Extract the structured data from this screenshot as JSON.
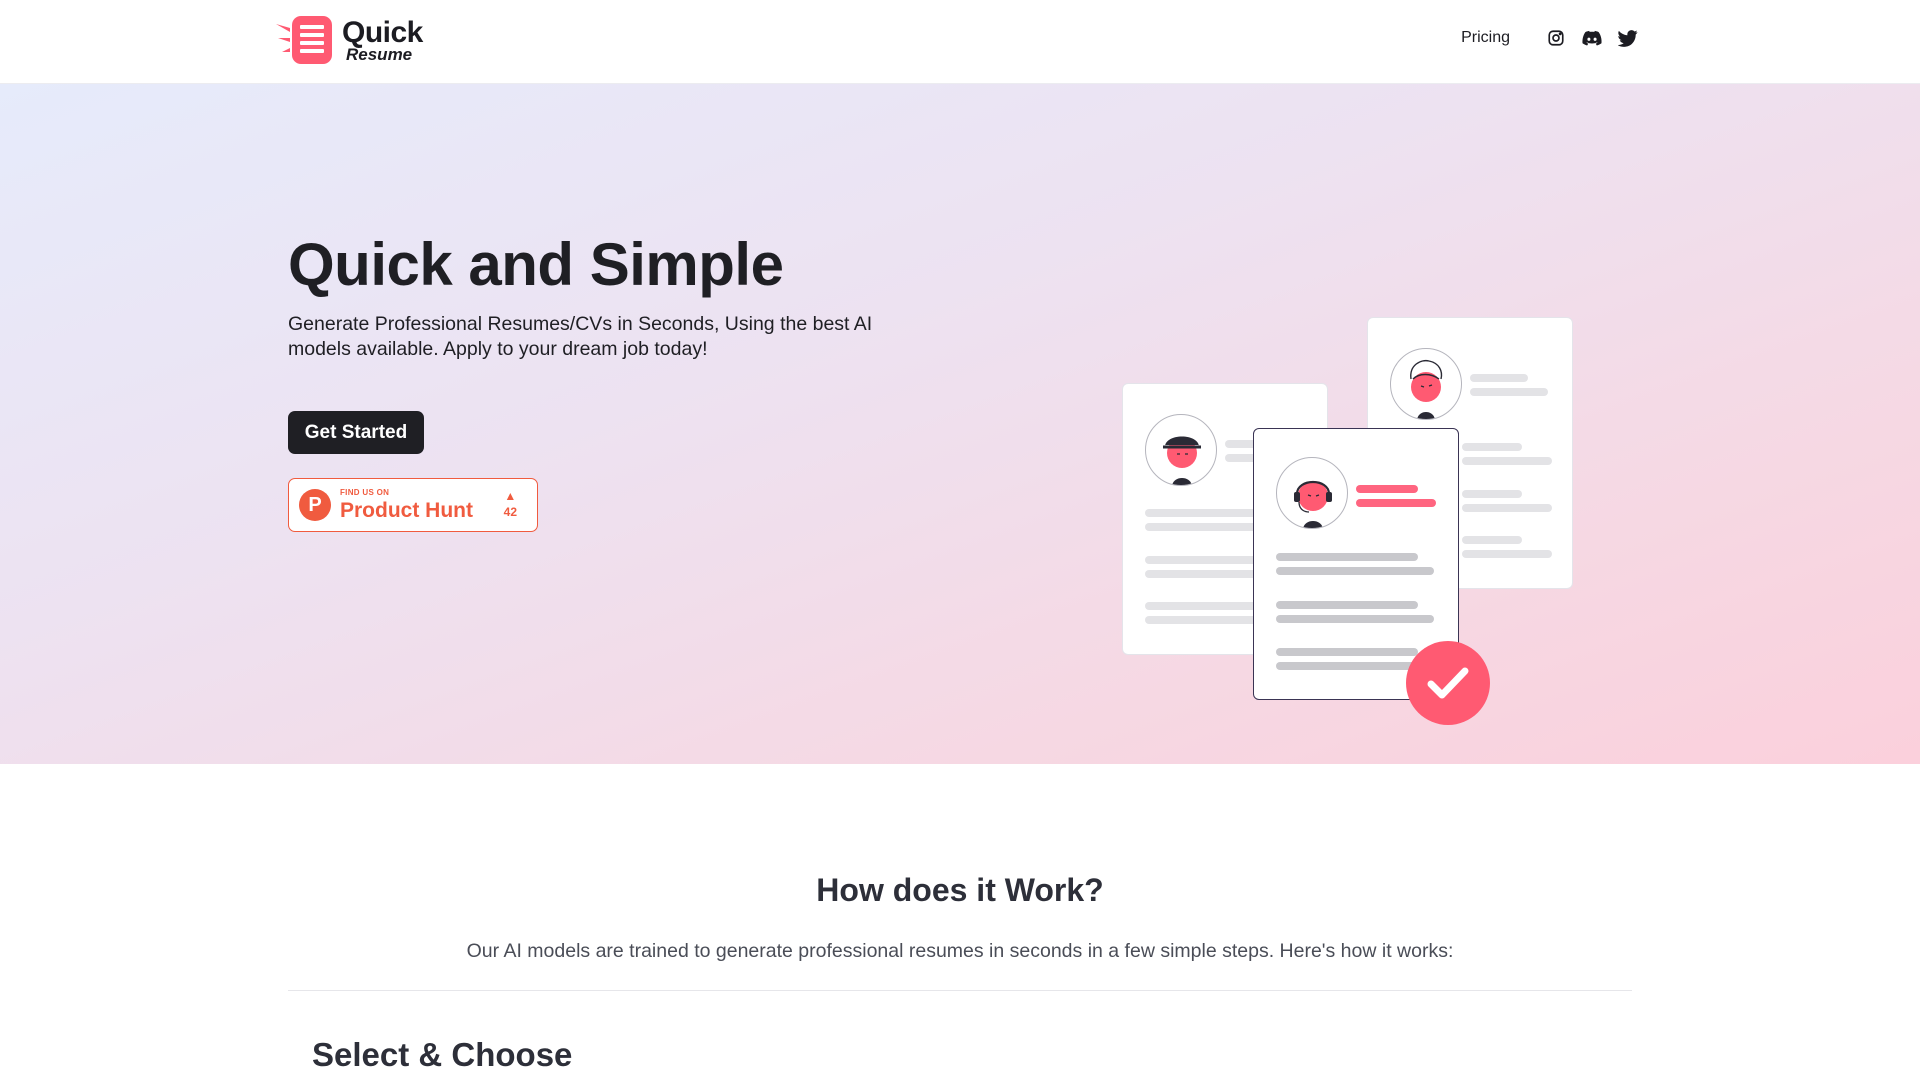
{
  "brand": {
    "name_line1": "Quick",
    "name_line2": "Resume",
    "accent": "#ff5a72"
  },
  "nav": {
    "pricing_label": "Pricing",
    "icons": [
      "instagram-icon",
      "discord-icon",
      "twitter-icon"
    ]
  },
  "hero": {
    "title": "Quick and Simple",
    "subtitle": "Generate Professional Resumes/CVs in Seconds, Using the best AI models available. Apply to your dream job today!",
    "cta_label": "Get Started",
    "product_hunt": {
      "badge_letter": "P",
      "small_label": "FIND US ON",
      "big_label": "Product Hunt",
      "upvote_arrow": "▲",
      "votes": "42",
      "color": "#f05b3f"
    }
  },
  "how": {
    "title": "How does it Work?",
    "subtitle": "Our AI models are trained to generate professional resumes in seconds in a few simple steps. Here's how it works:",
    "first_step_title": "Select & Choose"
  }
}
